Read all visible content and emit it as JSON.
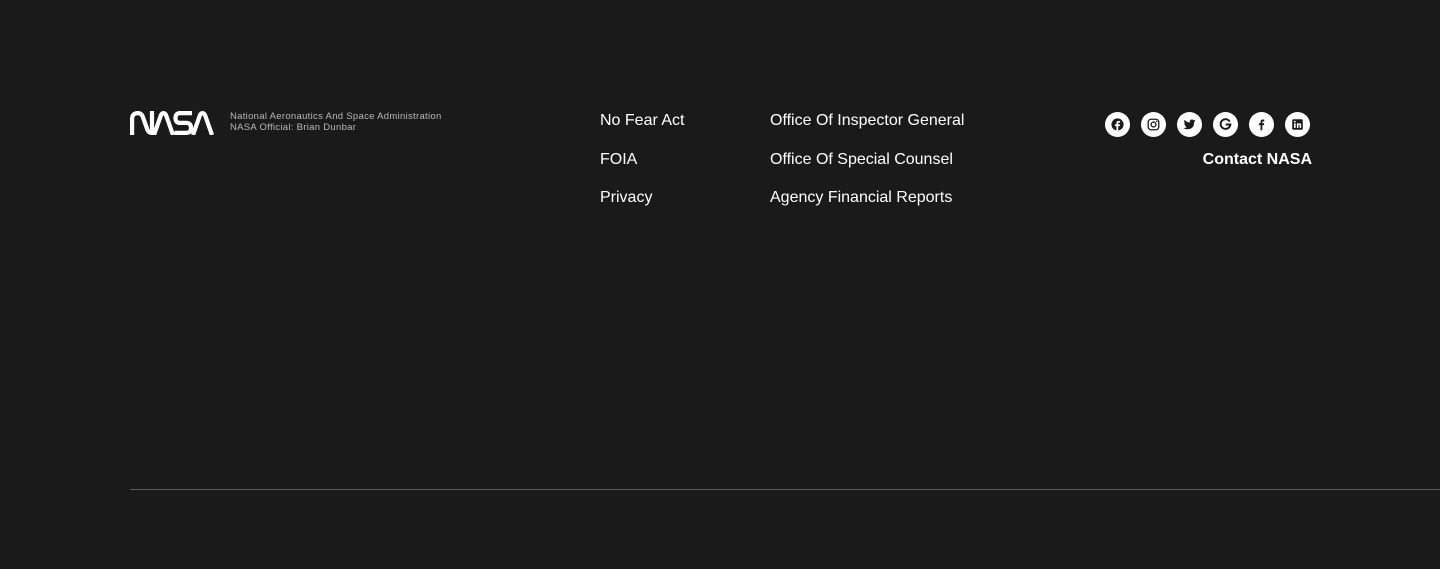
{
  "brand": {
    "logo_text": "NASA",
    "agency_name": "National Aeronautics And Space Administration",
    "official": "NASA Official: Brian Dunbar"
  },
  "links": {
    "column1": [
      {
        "label": "No Fear Act"
      },
      {
        "label": "FOIA"
      },
      {
        "label": "Privacy"
      }
    ],
    "column2": [
      {
        "label": "Office Of Inspector General"
      },
      {
        "label": "Office Of Special Counsel"
      },
      {
        "label": "Agency Financial Reports"
      }
    ]
  },
  "social": [
    {
      "icon": "facebook-icon"
    },
    {
      "icon": "instagram-icon"
    },
    {
      "icon": "twitter-icon"
    },
    {
      "icon": "google-icon"
    },
    {
      "icon": "facebook-f-icon"
    },
    {
      "icon": "linkedin-icon"
    }
  ],
  "contact": {
    "label": "Contact NASA"
  },
  "colors": {
    "background": "#1a1a1a",
    "text": "#ffffff",
    "muted_text": "#b8b8b8",
    "divider": "#5a5a5a"
  }
}
